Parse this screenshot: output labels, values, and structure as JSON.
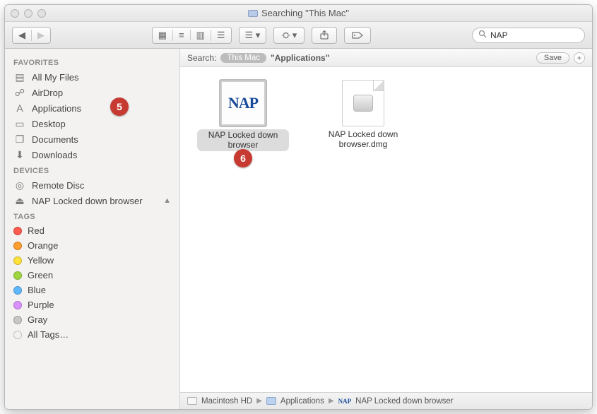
{
  "window": {
    "title": "Searching \"This Mac\""
  },
  "search": {
    "value": "NAP",
    "placeholder": "Search"
  },
  "sidebar": {
    "sections": [
      {
        "title": "FAVORITES",
        "items": [
          {
            "label": "All My Files",
            "icon": "all-files-icon"
          },
          {
            "label": "AirDrop",
            "icon": "airdrop-icon"
          },
          {
            "label": "Applications",
            "icon": "applications-icon"
          },
          {
            "label": "Desktop",
            "icon": "desktop-icon"
          },
          {
            "label": "Documents",
            "icon": "documents-icon"
          },
          {
            "label": "Downloads",
            "icon": "downloads-icon"
          }
        ]
      },
      {
        "title": "DEVICES",
        "items": [
          {
            "label": "Remote Disc",
            "icon": "disc-icon"
          },
          {
            "label": "NAP Locked down browser",
            "icon": "volume-icon",
            "eject": true
          }
        ]
      },
      {
        "title": "TAGS",
        "items": [
          {
            "label": "Red",
            "color": "#ff5b4f"
          },
          {
            "label": "Orange",
            "color": "#ff9d2f"
          },
          {
            "label": "Yellow",
            "color": "#ffe23a"
          },
          {
            "label": "Green",
            "color": "#9fd63f"
          },
          {
            "label": "Blue",
            "color": "#5fb8ff"
          },
          {
            "label": "Purple",
            "color": "#d992ff"
          },
          {
            "label": "Gray",
            "color": "#c7c7c7"
          },
          {
            "label": "All Tags…",
            "color": null
          }
        ]
      }
    ]
  },
  "scope": {
    "label": "Search:",
    "active": "This Mac",
    "other": "\"Applications\"",
    "save": "Save"
  },
  "results": [
    {
      "name": "NAP Locked down browser",
      "kind": "app",
      "selected": true,
      "thumb": "NAP"
    },
    {
      "name": "NAP Locked down browser.dmg",
      "kind": "dmg",
      "selected": false
    }
  ],
  "pathbar": [
    {
      "label": "Macintosh HD",
      "icon": "drive"
    },
    {
      "label": "Applications",
      "icon": "folder"
    },
    {
      "label": "NAP Locked down browser",
      "icon": "app"
    }
  ],
  "callouts": {
    "c5": "5",
    "c6": "6"
  }
}
